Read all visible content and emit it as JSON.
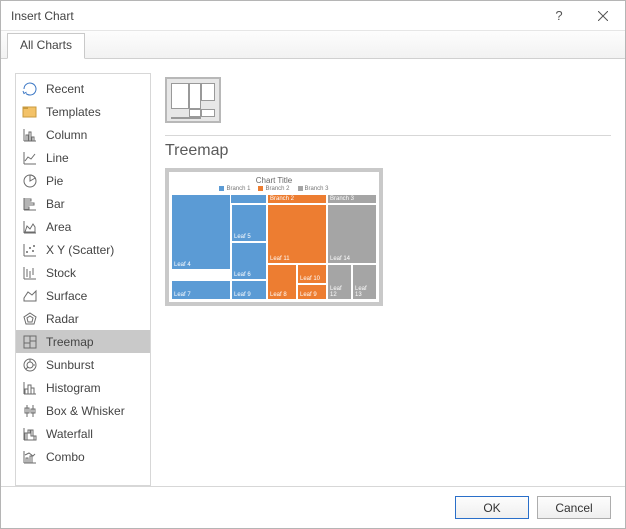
{
  "window": {
    "title": "Insert Chart"
  },
  "tab": {
    "label": "All Charts"
  },
  "sidebar": {
    "items": [
      {
        "label": "Recent"
      },
      {
        "label": "Templates"
      },
      {
        "label": "Column"
      },
      {
        "label": "Line"
      },
      {
        "label": "Pie"
      },
      {
        "label": "Bar"
      },
      {
        "label": "Area"
      },
      {
        "label": "X Y (Scatter)"
      },
      {
        "label": "Stock"
      },
      {
        "label": "Surface"
      },
      {
        "label": "Radar"
      },
      {
        "label": "Treemap"
      },
      {
        "label": "Sunburst"
      },
      {
        "label": "Histogram"
      },
      {
        "label": "Box & Whisker"
      },
      {
        "label": "Waterfall"
      },
      {
        "label": "Combo"
      }
    ],
    "selected_index": 11
  },
  "chart": {
    "type_label": "Treemap",
    "preview_title": "Chart Title",
    "legend": [
      "Branch 1",
      "Branch 2",
      "Branch 3"
    ]
  },
  "chart_data": {
    "type": "treemap",
    "title": "Chart Title",
    "series": [
      {
        "name": "Branch 1",
        "color": "#5b9bd5",
        "children": [
          {
            "name": "Leaf 4",
            "value": 30
          },
          {
            "name": "Leaf 5",
            "value": 12
          },
          {
            "name": "Leaf 6",
            "value": 12
          },
          {
            "name": "Leaf 7",
            "value": 8
          },
          {
            "name": "Leaf 9",
            "value": 8
          }
        ]
      },
      {
        "name": "Branch 2",
        "color": "#ed7d31",
        "children": [
          {
            "name": "Leaf 11",
            "value": 22
          },
          {
            "name": "Leaf 8",
            "value": 7
          },
          {
            "name": "Leaf 10",
            "value": 7
          },
          {
            "name": "Leaf 9",
            "value": 6
          }
        ]
      },
      {
        "name": "Branch 3",
        "color": "#a5a5a5",
        "children": [
          {
            "name": "Leaf 14",
            "value": 18
          },
          {
            "name": "Leaf 12",
            "value": 6
          },
          {
            "name": "Leaf 13",
            "value": 6
          }
        ]
      }
    ]
  },
  "footer": {
    "ok": "OK",
    "cancel": "Cancel"
  }
}
